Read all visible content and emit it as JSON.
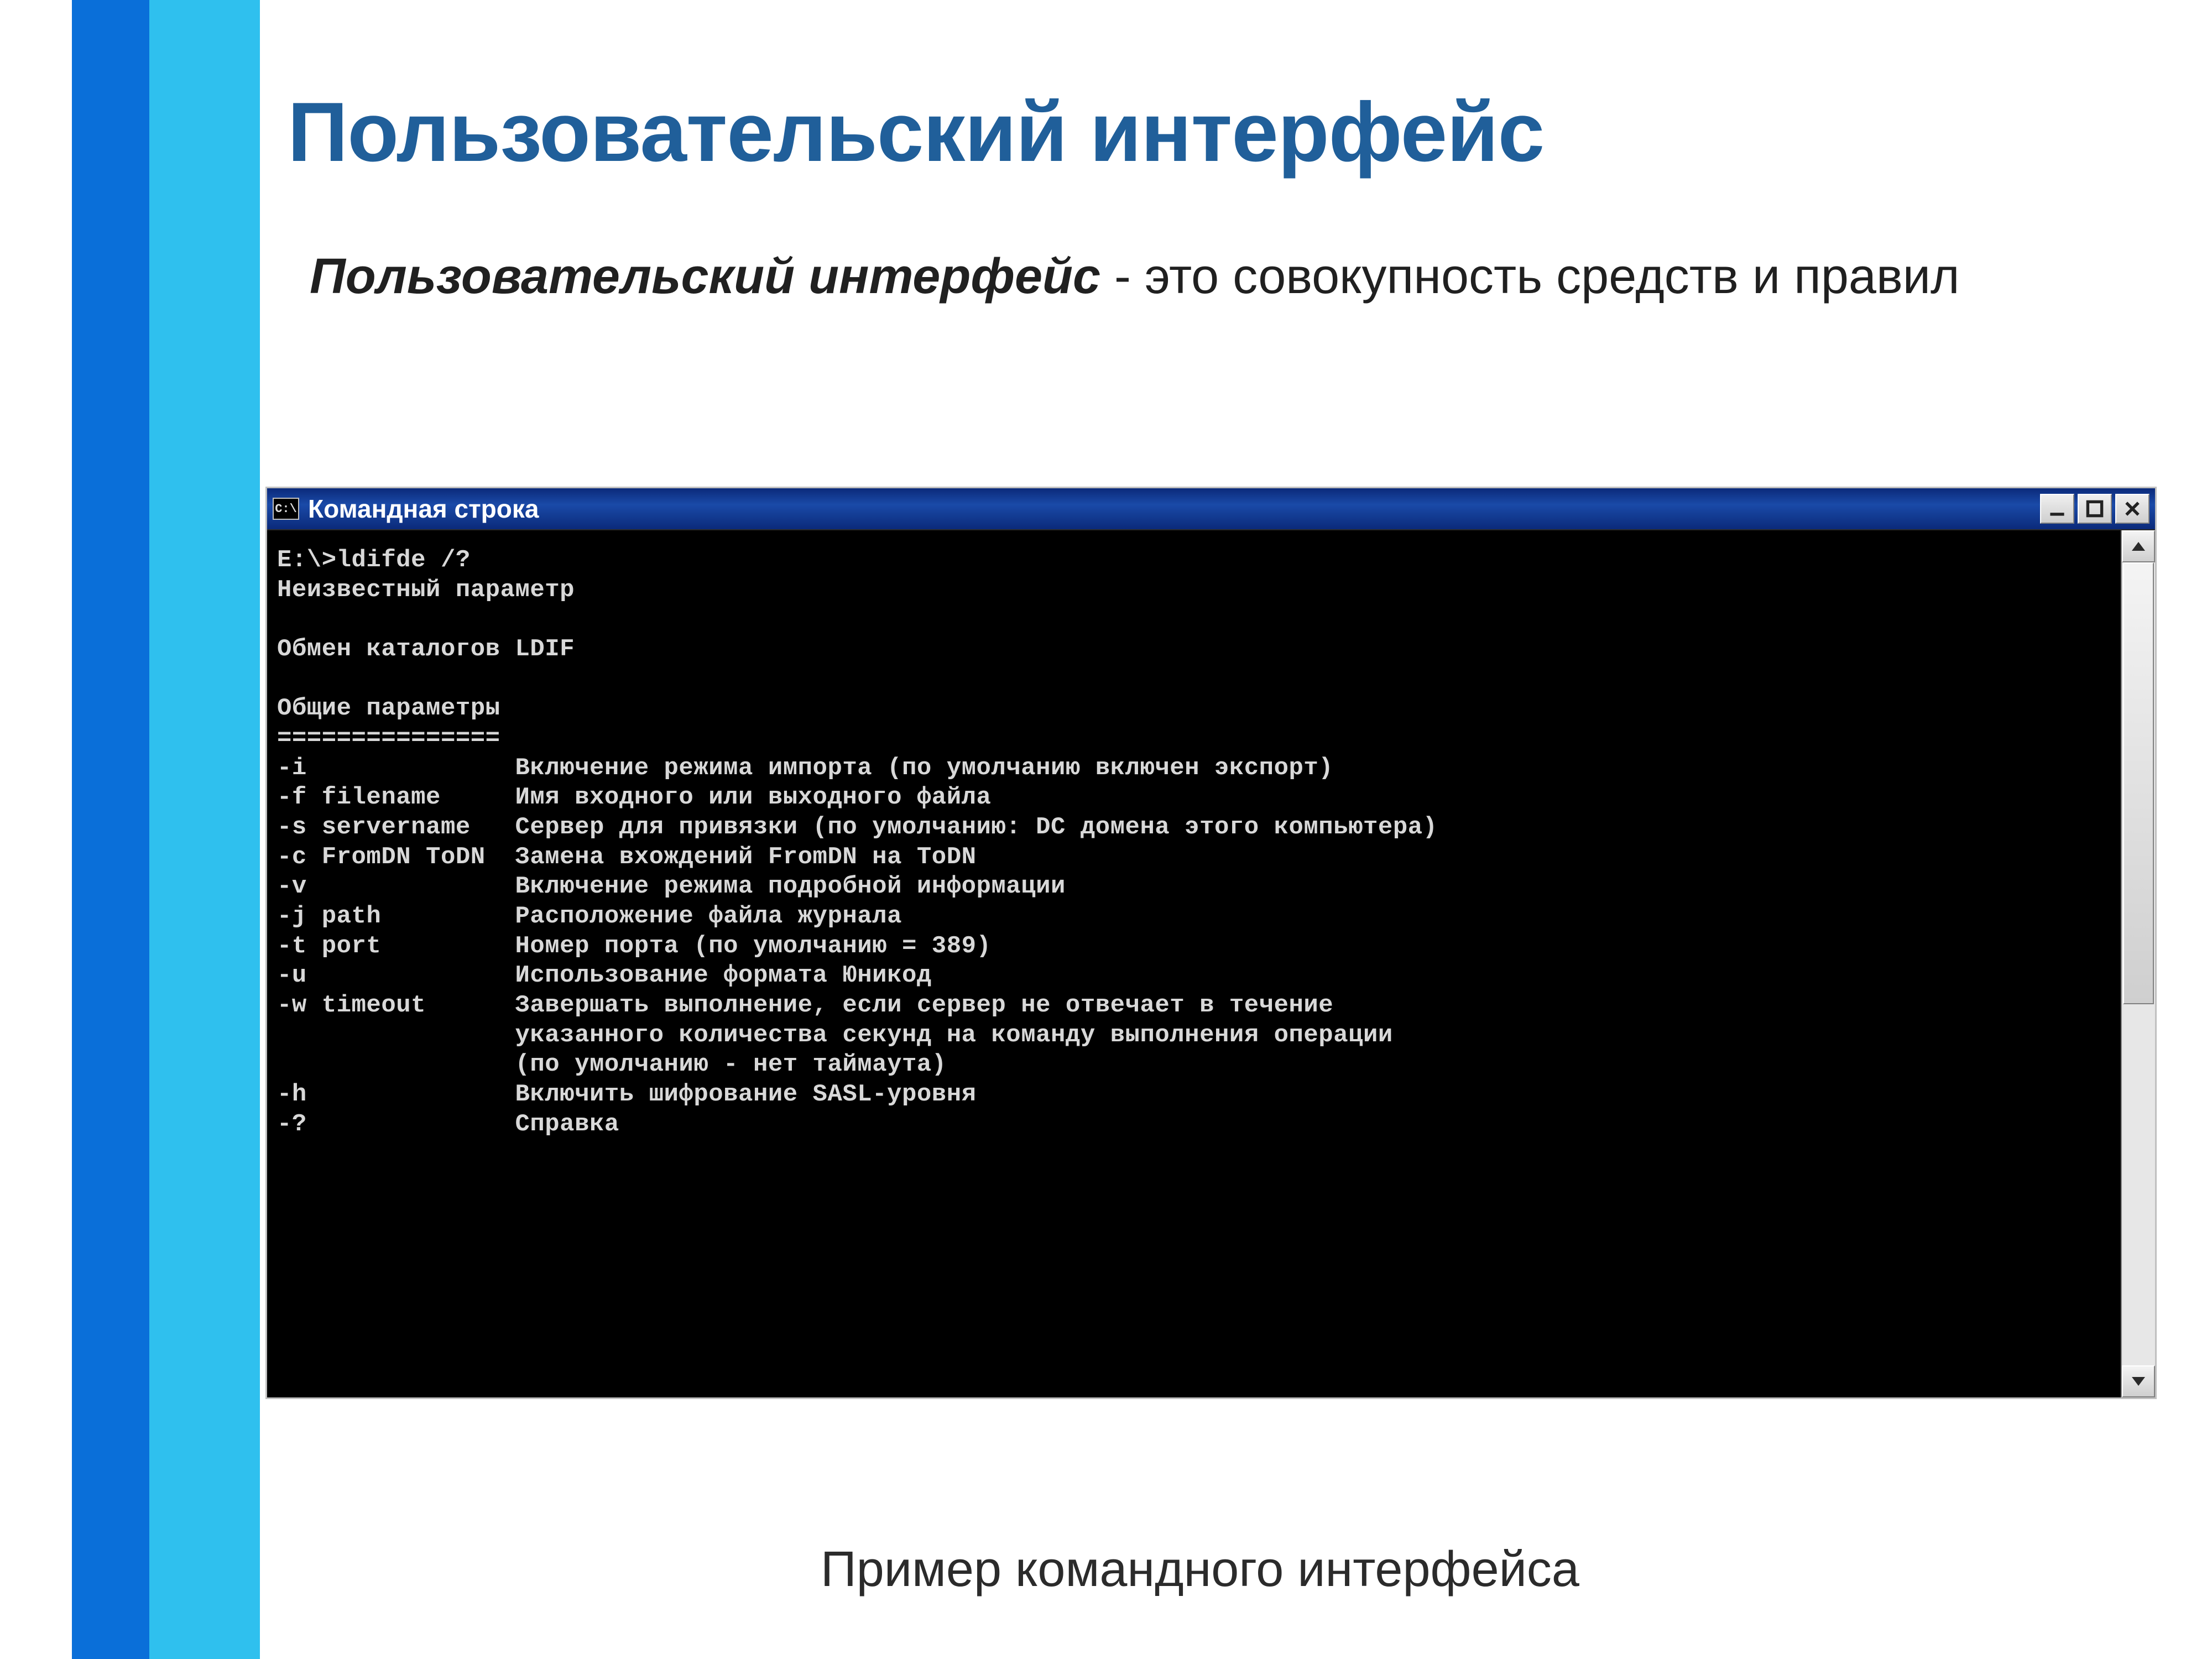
{
  "slide": {
    "title": "Пользовательский интерфейс",
    "term": "Пользовательский интерфейс",
    "definition_tail": " - это совокупность средств и правил",
    "caption": "Пример командного интерфейса"
  },
  "cmd": {
    "icon_text": "C:\\",
    "title": "Командная строка",
    "lines": "E:\\>ldifde /?\nНеизвестный параметр\n\nОбмен каталогов LDIF\n\nОбщие параметры\n===============\n-i              Включение режима импорта (по умолчанию включен экспорт)\n-f filename     Имя входного или выходного файла\n-s servername   Сервер для привязки (по умолчанию: DC домена этого компьютера)\n-c FromDN ToDN  Замена вхождений FromDN на ToDN\n-v              Включение режима подробной информации\n-j path         Расположение файла журнала\n-t port         Номер порта (по умолчанию = 389)\n-u              Использование формата Юникод\n-w timeout      Завершать выполнение, если сервер не отвечает в течение\n                указанного количества секунд на команду выполнения операции\n                (по умолчанию - нет таймаута)\n-h              Включить шифрование SASL-уровня\n-?              Справка\n"
  }
}
